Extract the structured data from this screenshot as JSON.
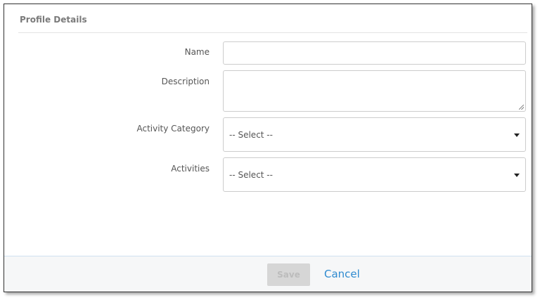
{
  "panel": {
    "title": "Profile Details"
  },
  "form": {
    "name_label": "Name",
    "name_value": "",
    "description_label": "Description",
    "description_value": "",
    "activity_category_label": "Activity Category",
    "activity_category_value": "-- Select --",
    "activities_label": "Activities",
    "activities_value": "-- Select --"
  },
  "footer": {
    "save_label": "Save",
    "cancel_label": "Cancel"
  }
}
